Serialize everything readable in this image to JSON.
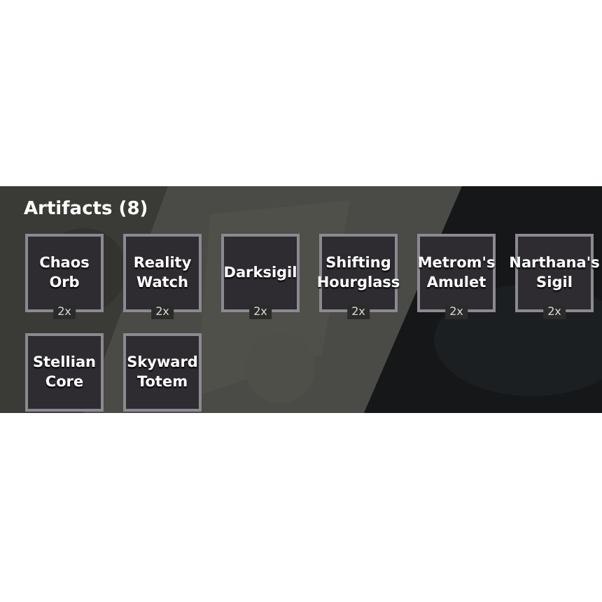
{
  "section": {
    "title": "Artifacts (8)"
  },
  "artifacts": [
    {
      "name": "Chaos Orb",
      "count": "2x"
    },
    {
      "name": "Reality Watch",
      "count": "2x"
    },
    {
      "name": "Darksigil",
      "count": "2x"
    },
    {
      "name": "Shifting Hourglass",
      "count": "2x"
    },
    {
      "name": "Metrom's Amulet",
      "count": "2x"
    },
    {
      "name": "Narthana's Sigil",
      "count": "2x"
    },
    {
      "name": "Stellian Core"
    },
    {
      "name": "Skyward Totem"
    }
  ]
}
